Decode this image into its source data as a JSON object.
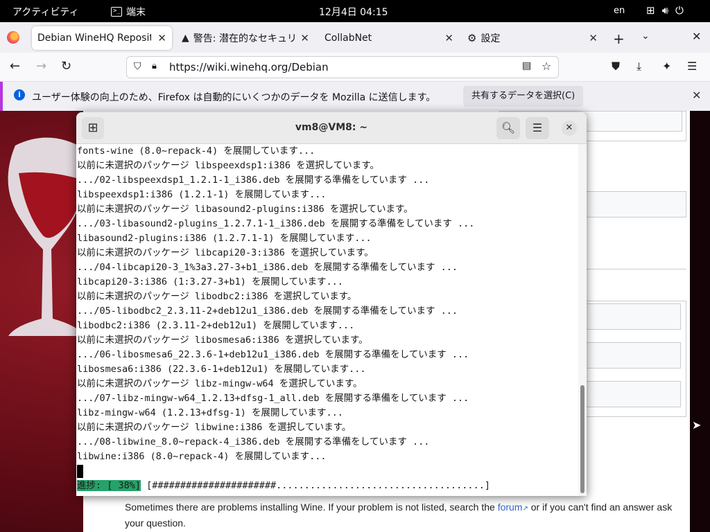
{
  "topbar": {
    "activities": "アクティビティ",
    "app_name": "端末",
    "clock": "12月4日 04:15",
    "input_lang": "en"
  },
  "browser": {
    "tabs": [
      {
        "label": "Debian WineHQ Repositor",
        "active": true
      },
      {
        "label": "警告: 潜在的なセキュリ",
        "active": false
      },
      {
        "label": "CollabNet",
        "active": false
      },
      {
        "label": "設定",
        "active": false
      }
    ],
    "url": "https://wiki.winehq.org/Debian",
    "notification": {
      "message": "ユーザー体験の向上のため、Firefox は自動的にいくつかのデータを Mozilla に送信します。",
      "button": "共有するデータを選択(C)"
    }
  },
  "terminal": {
    "title": "vm8@VM8: ~",
    "lines": [
      "fonts-wine (8.0~repack-4) を展開しています...",
      "以前に未選択のパッケージ libspeexdsp1:i386 を選択しています。",
      ".../02-libspeexdsp1_1.2.1-1_i386.deb を展開する準備をしています ...",
      "libspeexdsp1:i386 (1.2.1-1) を展開しています...",
      "以前に未選択のパッケージ libasound2-plugins:i386 を選択しています。",
      ".../03-libasound2-plugins_1.2.7.1-1_i386.deb を展開する準備をしています ...",
      "libasound2-plugins:i386 (1.2.7.1-1) を展開しています...",
      "以前に未選択のパッケージ libcapi20-3:i386 を選択しています。",
      ".../04-libcapi20-3_1%3a3.27-3+b1_i386.deb を展開する準備をしています ...",
      "libcapi20-3:i386 (1:3.27-3+b1) を展開しています...",
      "以前に未選択のパッケージ libodbc2:i386 を選択しています。",
      ".../05-libodbc2_2.3.11-2+deb12u1_i386.deb を展開する準備をしています ...",
      "libodbc2:i386 (2.3.11-2+deb12u1) を展開しています...",
      "以前に未選択のパッケージ libosmesa6:i386 を選択しています。",
      ".../06-libosmesa6_22.3.6-1+deb12u1_i386.deb を展開する準備をしています ...",
      "libosmesa6:i386 (22.3.6-1+deb12u1) を展開しています...",
      "以前に未選択のパッケージ libz-mingw-w64 を選択しています。",
      ".../07-libz-mingw-w64_1.2.13+dfsg-1_all.deb を展開する準備をしています ...",
      "libz-mingw-w64 (1.2.13+dfsg-1) を展開しています...",
      "以前に未選択のパッケージ libwine:i386 を選択しています。",
      ".../08-libwine_8.0~repack-4_i386.deb を展開する準備をしています ...",
      "libwine:i386 (8.0~repack-4) を展開しています..."
    ],
    "progress_label": "進捗: [ 38%]",
    "progress_bar": " [######################.....................................]",
    "progress_percent": 38
  },
  "webpage": {
    "text_before_link": "Sometimes there are problems installing Wine. If your problem is not listed, search the ",
    "link": "forum",
    "text_after_link": " or if you can't find an answer ask your question."
  }
}
